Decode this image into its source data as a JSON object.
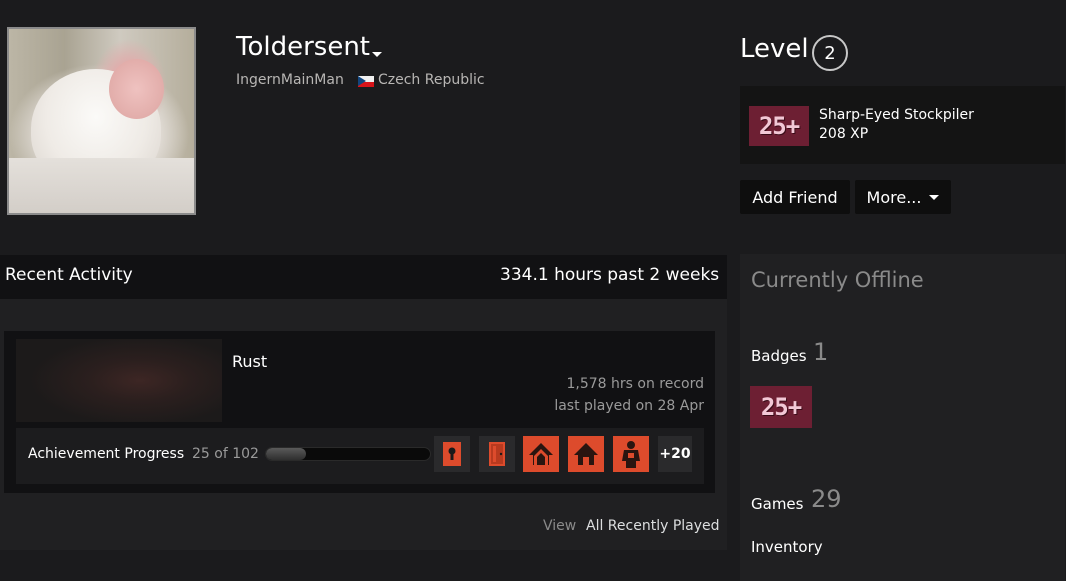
{
  "profile": {
    "persona_name": "Toldersent",
    "real_name": "IngernMainMan",
    "country": "Czech Republic"
  },
  "level": {
    "label": "Level",
    "value": "2"
  },
  "featured_badge": {
    "icon_text": "25+",
    "name": "Sharp-Eyed Stockpiler",
    "xp": "208 XP"
  },
  "actions": {
    "add_friend": "Add Friend",
    "more": "More..."
  },
  "activity": {
    "title": "Recent Activity",
    "hours": "334.1 hours past 2 weeks",
    "view_label": "View",
    "view_all": "All Recently Played",
    "game": {
      "name": "Rust",
      "hours_on_record": "1,578 hrs on record",
      "last_played": "last played on 28 Apr",
      "achievement_label": "Achievement Progress",
      "achievement_count": "25 of 102",
      "achievement_progress": 0.245,
      "achievement_icons": [
        "keyhole-icon",
        "door-icon",
        "house-icon",
        "house-icon",
        "survivor-icon"
      ],
      "more_achievements": "+20"
    }
  },
  "sidebar": {
    "status": "Currently Offline",
    "badges_label": "Badges",
    "badges_count": "1",
    "badge_icon_text": "25+",
    "games_label": "Games",
    "games_count": "29",
    "inventory_label": "Inventory"
  },
  "colors": {
    "background": "#1b1b1d",
    "panel": "#202022",
    "achievement_accent": "#dd4b2c",
    "badge": "#6d1f33"
  }
}
